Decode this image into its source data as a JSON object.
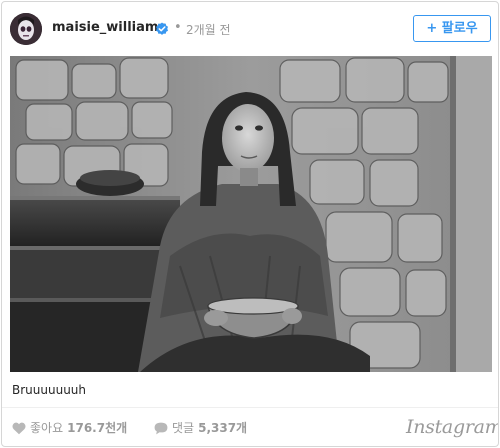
{
  "post": {
    "username": "maisie_williams",
    "time": "2개월 전",
    "follow_label": "+ 팔로우",
    "caption": "Bruuuuuuuh"
  },
  "footer": {
    "likes_label": "좋아요",
    "likes_count": "176.7천개",
    "comments_label": "댓글",
    "comments_count": "5,337개",
    "brand": "Instagram"
  },
  "icons": {
    "verified": "verified-badge-icon",
    "likes": "heart-icon",
    "comments": "speech-bubble-icon"
  },
  "colors": {
    "accent": "#3897f0",
    "muted": "#999999",
    "text": "#262626"
  }
}
